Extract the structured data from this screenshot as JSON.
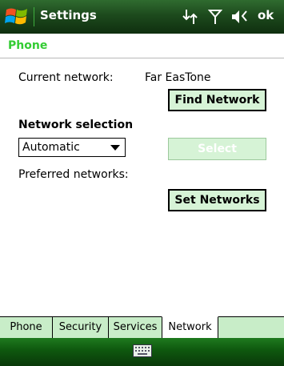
{
  "header": {
    "title": "Settings",
    "ok_label": "ok",
    "icons": [
      "windows-logo",
      "data-connectivity-icon",
      "signal-strength-icon",
      "volume-icon"
    ]
  },
  "page": {
    "title": "Phone"
  },
  "content": {
    "current_network_label": "Current network:",
    "current_network_value": "Far EasTone",
    "find_network_button": "Find Network",
    "network_selection_heading": "Network selection",
    "selection_mode": "Automatic",
    "select_button": "Select",
    "preferred_networks_label": "Preferred networks:",
    "set_networks_button": "Set Networks"
  },
  "tabs": [
    {
      "label": "Phone",
      "active": false
    },
    {
      "label": "Security",
      "active": false
    },
    {
      "label": "Services",
      "active": false
    },
    {
      "label": "Network",
      "active": true
    }
  ],
  "bottom": {
    "icon": "keyboard-icon"
  },
  "colors": {
    "accent": "#33cc33",
    "button_bg": "#d6f3d6",
    "topbar": "#1d4a1d",
    "tab_bg": "#c8edc8"
  }
}
